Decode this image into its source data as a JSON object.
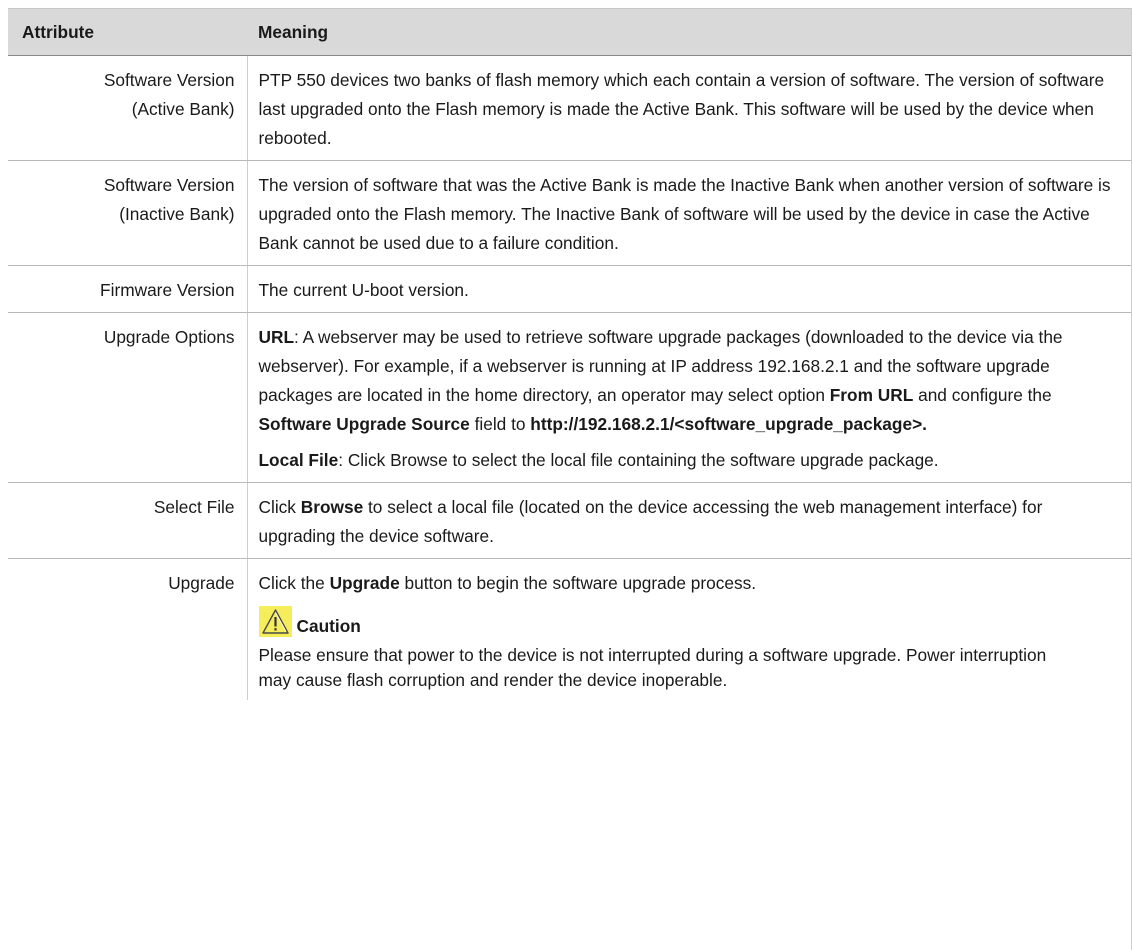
{
  "table": {
    "headers": {
      "attribute": "Attribute",
      "meaning": "Meaning"
    },
    "rows": [
      {
        "attr": [
          "Software Version",
          "(Active Bank)"
        ],
        "text": "PTP 550 devices two banks of flash memory which each contain a version of software. The version of software last upgraded onto the Flash memory is made the Active Bank. This software will be used by the device when rebooted."
      },
      {
        "attr": [
          "Software Version",
          "(Inactive Bank)"
        ],
        "text": "The version of software that was the Active Bank is made the Inactive Bank when another version of software is upgraded onto the Flash memory. The Inactive Bank of software will be used by the device in case the Active Bank cannot be used due to a failure condition."
      },
      {
        "attr": [
          "Firmware Version"
        ],
        "text": "The current U-boot version."
      },
      {
        "attr": [
          "Upgrade Options"
        ],
        "url_label": "URL",
        "url_text_1": ": A webserver may be used to retrieve software upgrade packages (downloaded to the device via the webserver). For example, if a webserver is running at IP address 192.168.2.1 and the software upgrade packages are located in the home directory, an operator may select option ",
        "from_url": "From URL",
        "url_text_2": " and configure the ",
        "sw_source": "Software Upgrade Source",
        "url_text_3": " field to ",
        "url_value": "http://192.168.2.1/<software_upgrade_package>.",
        "local_label": "Local File",
        "local_text": ": Click Browse to select the local file containing the software upgrade package."
      },
      {
        "attr": [
          "Select File"
        ],
        "text_1": "Click ",
        "browse": "Browse",
        "text_2": " to select a local file (located on the device accessing the web management interface) for upgrading the device software."
      },
      {
        "attr": [
          "Upgrade"
        ],
        "text_1": "Click the ",
        "upgrade": "Upgrade",
        "text_2": " button to begin the software upgrade process.",
        "caution_title": "Caution",
        "caution_icon": "warning-triangle-icon",
        "caution_text": "Please ensure that power to the device is not interrupted during a software upgrade. Power interruption may cause flash corruption and render the device inoperable."
      }
    ]
  },
  "colors": {
    "header_bg": "#d9d9d9",
    "caution_icon_bg": "#f6ed5a"
  }
}
